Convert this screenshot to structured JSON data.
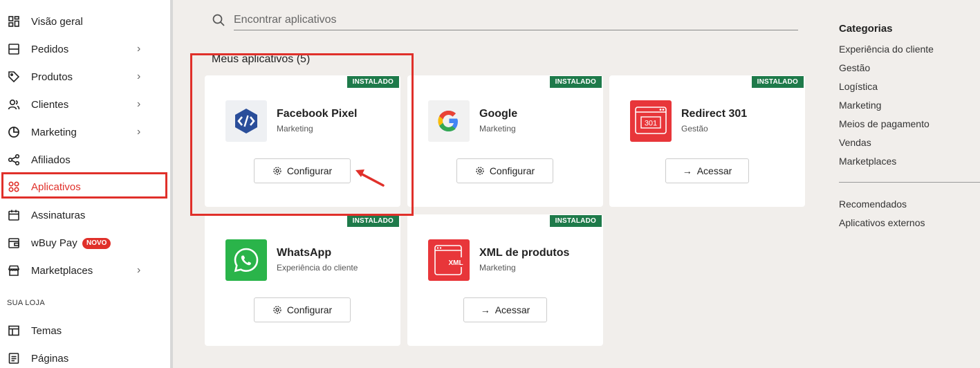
{
  "sidebar": {
    "items": [
      {
        "label": "Visão geral",
        "icon": "dashboard-icon",
        "chevron": ""
      },
      {
        "label": "Pedidos",
        "icon": "orders-icon",
        "chevron": "›"
      },
      {
        "label": "Produtos",
        "icon": "tag-icon",
        "chevron": "›"
      },
      {
        "label": "Clientes",
        "icon": "users-icon",
        "chevron": "›"
      },
      {
        "label": "Marketing",
        "icon": "pie-chart-icon",
        "chevron": "›"
      },
      {
        "label": "Afiliados",
        "icon": "share-icon",
        "chevron": ""
      },
      {
        "label": "Aplicativos",
        "icon": "apps-icon",
        "chevron": ""
      },
      {
        "label": "Assinaturas",
        "icon": "calendar-icon",
        "chevron": ""
      },
      {
        "label": "wBuy Pay",
        "icon": "wallet-icon",
        "chevron": "",
        "badge": "NOVO"
      },
      {
        "label": "Marketplaces",
        "icon": "store-icon",
        "chevron": "›"
      }
    ],
    "section_title": "SUA LOJA",
    "store_items": [
      {
        "label": "Temas",
        "icon": "layout-icon"
      },
      {
        "label": "Páginas",
        "icon": "page-icon"
      }
    ]
  },
  "search": {
    "placeholder": "Encontrar aplicativos"
  },
  "my_apps": {
    "heading": "Meus aplicativos (5)",
    "apps": [
      {
        "name": "Facebook Pixel",
        "category": "Marketing",
        "badge": "INSTALADO",
        "button": "Configurar",
        "button_icon": "gear-icon",
        "logo": "facebook-pixel-logo"
      },
      {
        "name": "Google",
        "category": "Marketing",
        "badge": "INSTALADO",
        "button": "Configurar",
        "button_icon": "gear-icon",
        "logo": "google-logo"
      },
      {
        "name": "Redirect 301",
        "category": "Gestão",
        "badge": "INSTALADO",
        "button": "Acessar",
        "button_icon": "arrow-right-icon",
        "logo": "redirect-301-logo",
        "logo_text": "301"
      },
      {
        "name": "WhatsApp",
        "category": "Experiência do cliente",
        "badge": "INSTALADO",
        "button": "Configurar",
        "button_icon": "gear-icon",
        "logo": "whatsapp-logo"
      },
      {
        "name": "XML de produtos",
        "category": "Marketing",
        "badge": "INSTALADO",
        "button": "Acessar",
        "button_icon": "arrow-right-icon",
        "logo": "xml-logo",
        "logo_text": "XML"
      }
    ]
  },
  "categories": {
    "heading": "Categorias",
    "items": [
      "Experiência do cliente",
      "Gestão",
      "Logística",
      "Marketing",
      "Meios de pagamento",
      "Vendas",
      "Marketplaces"
    ],
    "extra": [
      "Recomendados",
      "Aplicativos externos"
    ]
  },
  "colors": {
    "accent": "#e0302a",
    "installed_badge": "#1e7a4a",
    "background": "#f1eeeb"
  }
}
